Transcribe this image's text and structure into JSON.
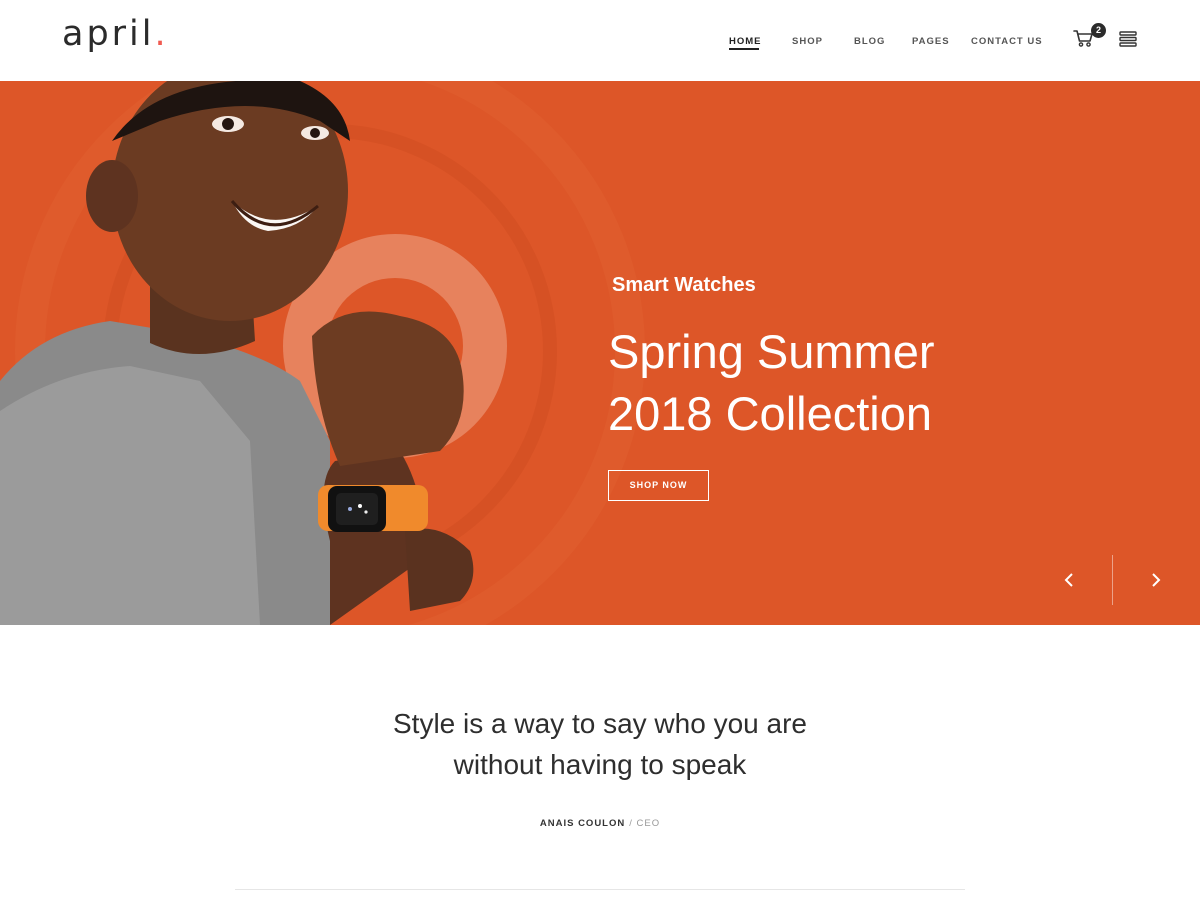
{
  "header": {
    "logo": {
      "text": "april",
      "dot": "."
    },
    "nav": [
      {
        "label": "HOME",
        "active": true
      },
      {
        "label": "SHOP",
        "active": false
      },
      {
        "label": "BLOG",
        "active": false
      },
      {
        "label": "PAGES",
        "active": false
      },
      {
        "label": "CONTACT US",
        "active": false
      }
    ],
    "cart": {
      "icon": "cart-icon",
      "count": "2"
    },
    "menu_icon": "hamburger-menu-icon"
  },
  "hero": {
    "subtitle": "Smart Watches",
    "title_line1": "Spring Summer",
    "title_line2": "2018 Collection",
    "button_label": "SHOP NOW",
    "prev_icon": "chevron-left-icon",
    "next_icon": "chevron-right-icon",
    "background_color": "#dd5628"
  },
  "quote": {
    "line1": "Style is a way to say who you are",
    "line2": "without having to speak",
    "author": "ANAIS COULON",
    "role": "/ CEO"
  },
  "colors": {
    "accent": "#f05a50",
    "hero_orange": "#dd5628",
    "text_dark": "#2b2b2b"
  }
}
